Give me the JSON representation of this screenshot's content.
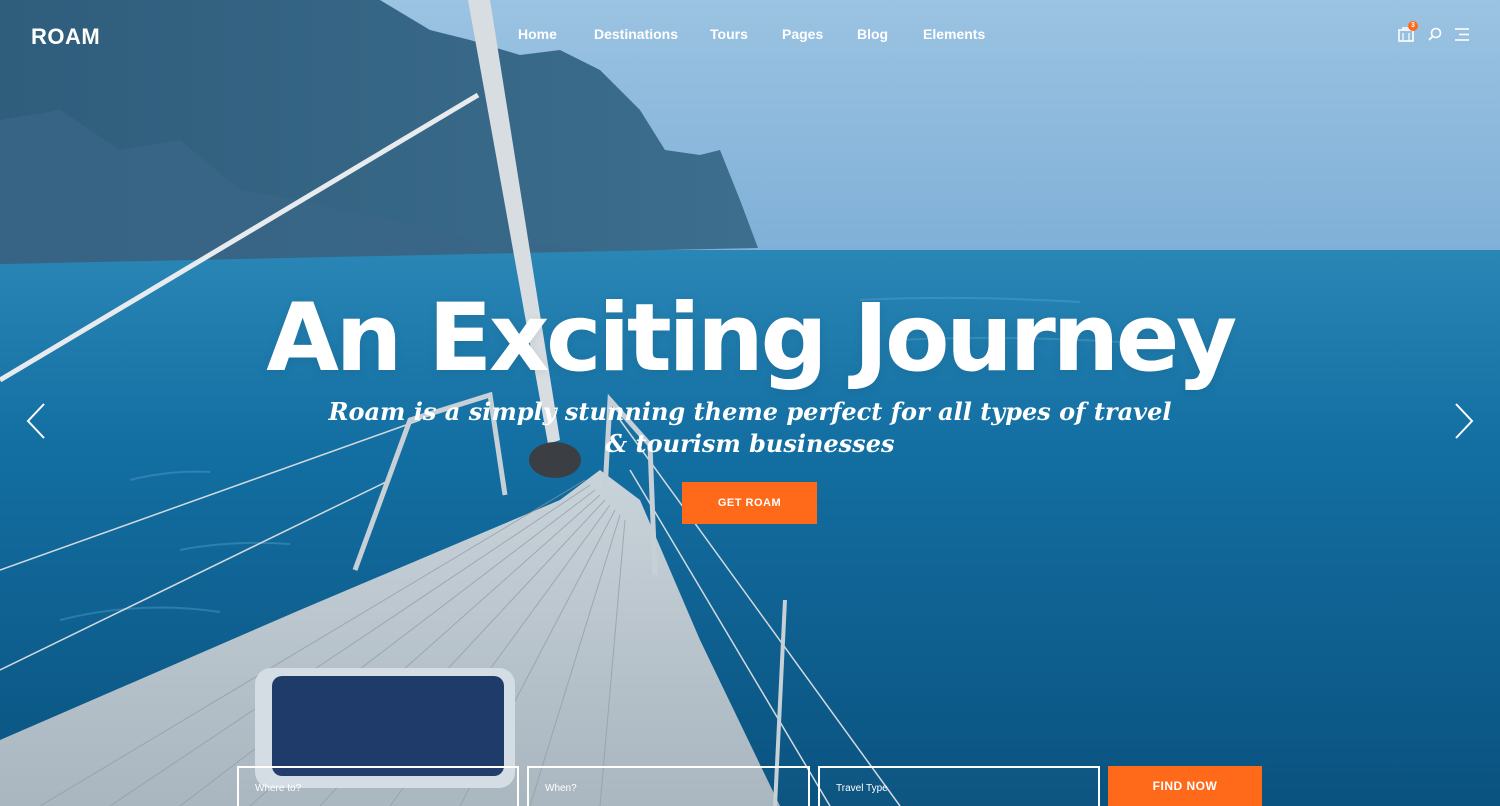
{
  "brand": {
    "logo_text": "ROAM"
  },
  "nav": {
    "items": [
      {
        "label": "Home"
      },
      {
        "label": "Destinations"
      },
      {
        "label": "Tours"
      },
      {
        "label": "Pages"
      },
      {
        "label": "Blog"
      },
      {
        "label": "Elements"
      }
    ]
  },
  "header_icons": {
    "cart_icon": "shopping-bag-icon",
    "cart_count": "3",
    "search_icon": "search-icon",
    "menu_icon": "hamburger-menu-icon"
  },
  "hero": {
    "headline": "An Exciting Journey",
    "subtitle_line1": "Roam is a simply stunning theme perfect for all types of travel",
    "subtitle_line2": "& tourism businesses",
    "cta_label": "GET ROAM"
  },
  "slider": {
    "prev_icon": "chevron-left-icon",
    "next_icon": "chevron-right-icon"
  },
  "search": {
    "where_placeholder": "Where to?",
    "when_placeholder": "When?",
    "type_placeholder": "Travel Type",
    "submit_label": "FIND NOW"
  },
  "colors": {
    "accent": "#ff6a1a",
    "text": "#ffffff",
    "sea": "#0f6a9c",
    "sky": "#8cb7dc"
  }
}
